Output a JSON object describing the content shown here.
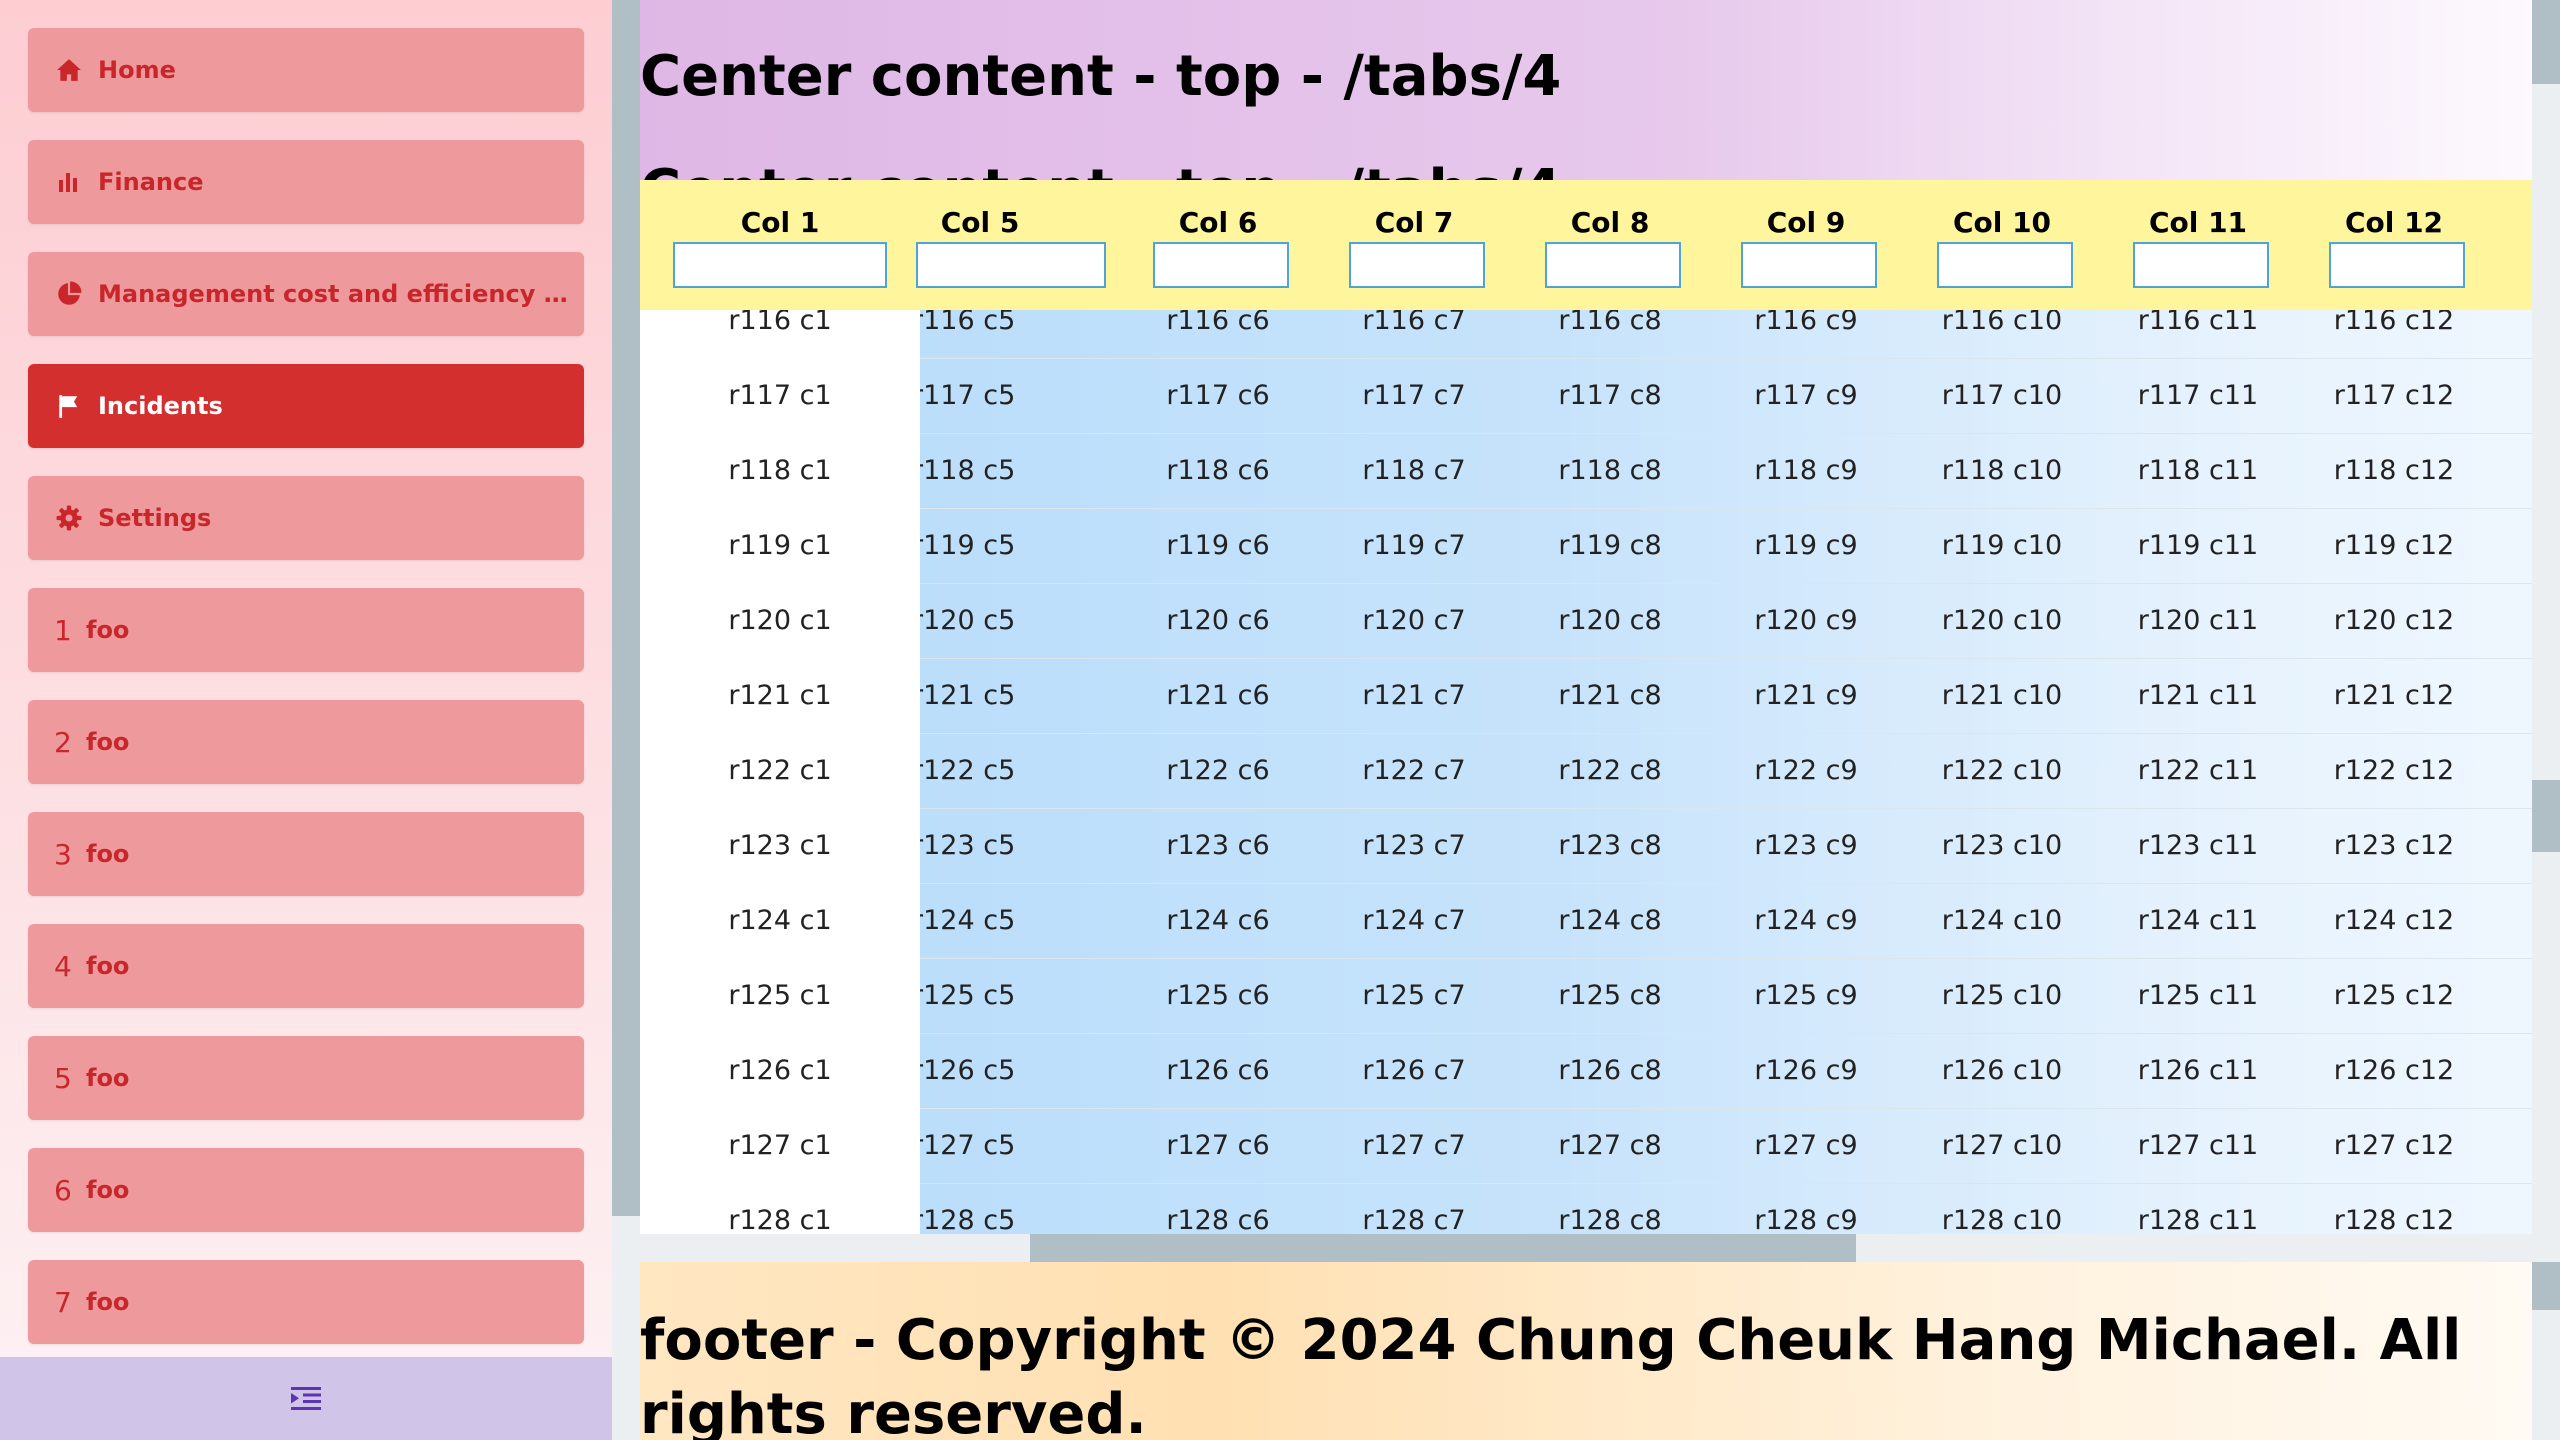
{
  "sidebar": {
    "items": [
      {
        "label": "Home",
        "icon": "home-icon",
        "active": false
      },
      {
        "label": "Finance",
        "icon": "bar-chart-icon",
        "active": false
      },
      {
        "label": "Management cost and efficiency r...",
        "icon": "pie-chart-icon",
        "active": false
      },
      {
        "label": "Incidents",
        "icon": "flag-icon",
        "active": true
      },
      {
        "label": "Settings",
        "icon": "gear-icon",
        "active": false
      },
      {
        "number": "1",
        "label": "foo",
        "active": false
      },
      {
        "number": "2",
        "label": "foo",
        "active": false
      },
      {
        "number": "3",
        "label": "foo",
        "active": false
      },
      {
        "number": "4",
        "label": "foo",
        "active": false
      },
      {
        "number": "5",
        "label": "foo",
        "active": false
      },
      {
        "number": "6",
        "label": "foo",
        "active": false
      },
      {
        "number": "7",
        "label": "foo",
        "active": false
      }
    ],
    "footer_icon": "collapse-menu-icon"
  },
  "header": {
    "title": "Center content - top - /tabs/4",
    "subtitle": "Center content - top - /tabs/4"
  },
  "grid": {
    "columns": [
      {
        "key": "c1",
        "title": "Col 1",
        "filter_value": ""
      },
      {
        "key": "c5",
        "title": "Col 5",
        "filter_value": ""
      },
      {
        "key": "c6",
        "title": "Col 6",
        "filter_value": ""
      },
      {
        "key": "c7",
        "title": "Col 7",
        "filter_value": ""
      },
      {
        "key": "c8",
        "title": "Col 8",
        "filter_value": ""
      },
      {
        "key": "c9",
        "title": "Col 9",
        "filter_value": ""
      },
      {
        "key": "c10",
        "title": "Col 10",
        "filter_value": ""
      },
      {
        "key": "c11",
        "title": "Col 11",
        "filter_value": ""
      },
      {
        "key": "c12",
        "title": "Col 12",
        "filter_value": ""
      }
    ],
    "rows": [
      [
        "r116 c1",
        "r116 c5",
        "r116 c6",
        "r116 c7",
        "r116 c8",
        "r116 c9",
        "r116 c10",
        "r116 c11",
        "r116 c12"
      ],
      [
        "r117 c1",
        "r117 c5",
        "r117 c6",
        "r117 c7",
        "r117 c8",
        "r117 c9",
        "r117 c10",
        "r117 c11",
        "r117 c12"
      ],
      [
        "r118 c1",
        "r118 c5",
        "r118 c6",
        "r118 c7",
        "r118 c8",
        "r118 c9",
        "r118 c10",
        "r118 c11",
        "r118 c12"
      ],
      [
        "r119 c1",
        "r119 c5",
        "r119 c6",
        "r119 c7",
        "r119 c8",
        "r119 c9",
        "r119 c10",
        "r119 c11",
        "r119 c12"
      ],
      [
        "r120 c1",
        "r120 c5",
        "r120 c6",
        "r120 c7",
        "r120 c8",
        "r120 c9",
        "r120 c10",
        "r120 c11",
        "r120 c12"
      ],
      [
        "r121 c1",
        "r121 c5",
        "r121 c6",
        "r121 c7",
        "r121 c8",
        "r121 c9",
        "r121 c10",
        "r121 c11",
        "r121 c12"
      ],
      [
        "r122 c1",
        "r122 c5",
        "r122 c6",
        "r122 c7",
        "r122 c8",
        "r122 c9",
        "r122 c10",
        "r122 c11",
        "r122 c12"
      ],
      [
        "r123 c1",
        "r123 c5",
        "r123 c6",
        "r123 c7",
        "r123 c8",
        "r123 c9",
        "r123 c10",
        "r123 c11",
        "r123 c12"
      ],
      [
        "r124 c1",
        "r124 c5",
        "r124 c6",
        "r124 c7",
        "r124 c8",
        "r124 c9",
        "r124 c10",
        "r124 c11",
        "r124 c12"
      ],
      [
        "r125 c1",
        "r125 c5",
        "r125 c6",
        "r125 c7",
        "r125 c8",
        "r125 c9",
        "r125 c10",
        "r125 c11",
        "r125 c12"
      ],
      [
        "r126 c1",
        "r126 c5",
        "r126 c6",
        "r126 c7",
        "r126 c8",
        "r126 c9",
        "r126 c10",
        "r126 c11",
        "r126 c12"
      ],
      [
        "r127 c1",
        "r127 c5",
        "r127 c6",
        "r127 c7",
        "r127 c8",
        "r127 c9",
        "r127 c10",
        "r127 c11",
        "r127 c12"
      ],
      [
        "r128 c1",
        "r128 c5",
        "r128 c6",
        "r128 c7",
        "r128 c8",
        "r128 c9",
        "r128 c10",
        "r128 c11",
        "r128 c12"
      ]
    ]
  },
  "footer": {
    "text": "footer - Copyright © 2024 Chung Cheuk Hang Michael. All rights reserved."
  },
  "colors": {
    "sidebar_item": "#ee999b",
    "sidebar_active": "#d32f2f",
    "sidebar_text": "#c8262b",
    "grid_header": "#fff59d",
    "filter_border": "#4fa3d9"
  }
}
